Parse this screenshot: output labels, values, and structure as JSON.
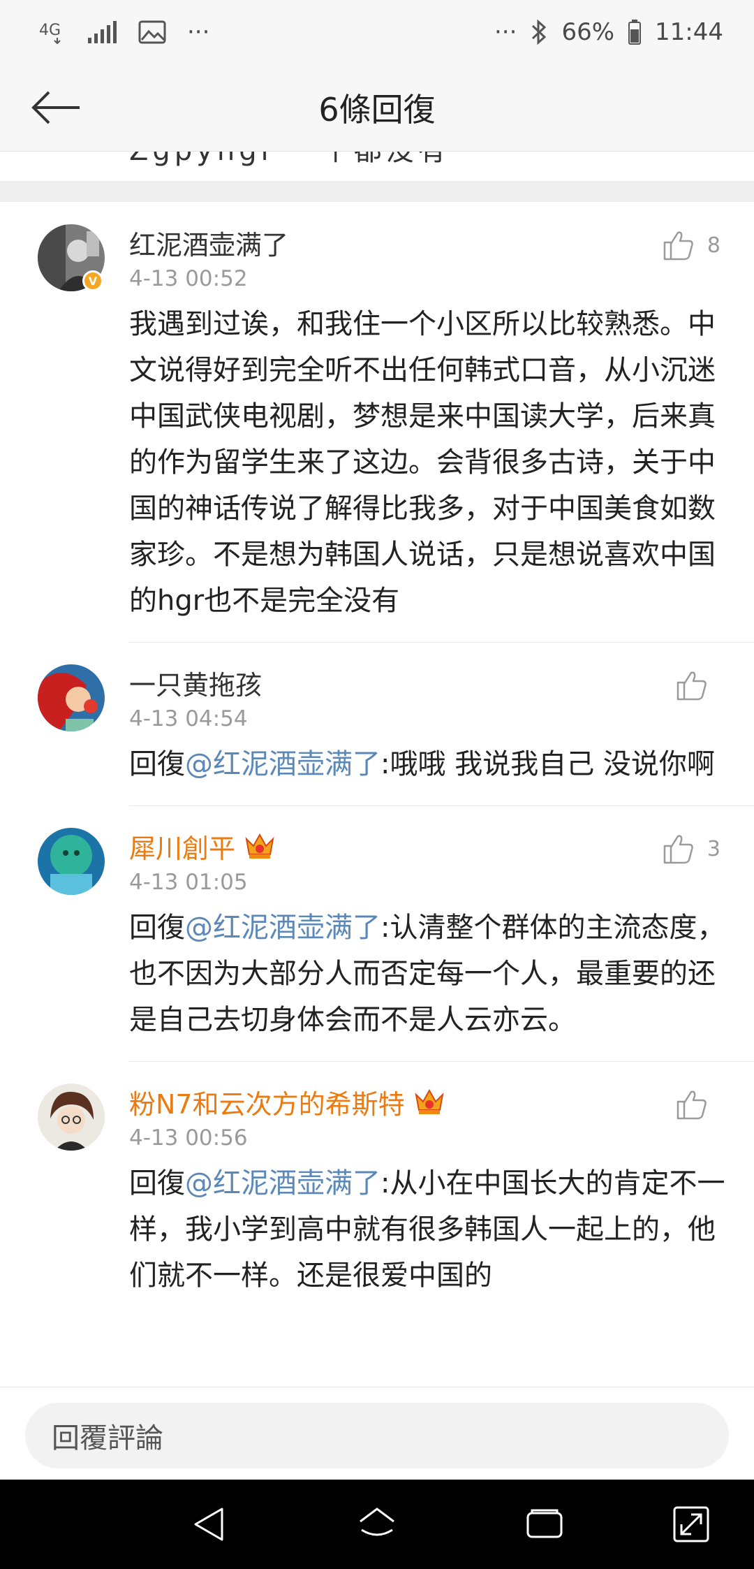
{
  "status_bar": {
    "network": "4G",
    "more": "···",
    "battery": "66%",
    "time": "11:44"
  },
  "header": {
    "title": "6條回復"
  },
  "previous_line": "Zgpyhgr 一个都没有",
  "comments": [
    {
      "name": "红泥酒壶满了",
      "verified": true,
      "vip": false,
      "likes": "8",
      "time": "4-13 00:52",
      "reply_prefix": "",
      "mention": "",
      "text": "我遇到过诶，和我住一个小区所以比较熟悉。中文说得好到完全听不出任何韩式口音，从小沉迷中国武侠电视剧，梦想是来中国读大学，后来真的作为留学生来了这边。会背很多古诗，关于中国的神话传说了解得比我多，对于中国美食如数家珍。不是想为韩国人说话，只是想说喜欢中国的hgr也不是完全没有"
    },
    {
      "name": "一只黄拖孩",
      "verified": false,
      "vip": false,
      "likes": "",
      "time": "4-13 04:54",
      "reply_prefix": "回復",
      "mention": "@红泥酒壶满了",
      "text": ":哦哦 我说我自己 没说你啊"
    },
    {
      "name": "犀川創平",
      "verified": false,
      "vip": true,
      "likes": "3",
      "time": "4-13 01:05",
      "reply_prefix": "回復",
      "mention": "@红泥酒壶满了",
      "text": ":认清整个群体的主流态度，也不因为大部分人而否定每一个人，最重要的还是自己去切身体会而不是人云亦云。"
    },
    {
      "name": "粉N7和云次方的希斯特",
      "verified": false,
      "vip": true,
      "likes": "",
      "time": "4-13 00:56",
      "reply_prefix": "回復",
      "mention": "@红泥酒壶满了",
      "text": ":从小在中国长大的肯定不一样，我小学到高中就有很多韩国人一起上的，他们就不一样。还是很爱中国的"
    }
  ],
  "input": {
    "placeholder": "回覆評論"
  },
  "colors": {
    "accent_link": "#5b88b8",
    "vip_name": "#eb7a10",
    "meta_gray": "#9a9a9a"
  }
}
